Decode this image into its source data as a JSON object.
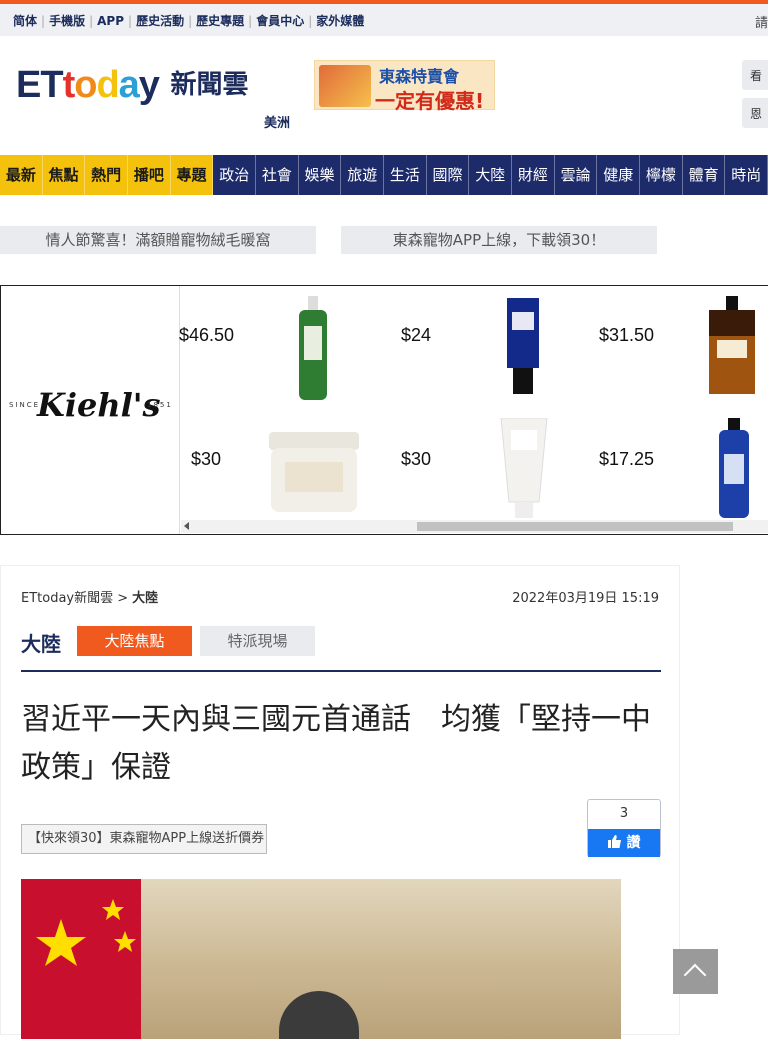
{
  "topbar": {
    "links": [
      "简体",
      "手機版",
      "APP",
      "歷史活動",
      "歷史專題",
      "會員中心",
      "家外媒體"
    ],
    "right_text": "請"
  },
  "header": {
    "logo_et": "ETtoday",
    "logo_cn": "新聞雲",
    "region": "美洲",
    "ad_line1": "東森特賣會",
    "ad_line2": "一定有優惠!",
    "side_buttons": [
      "看",
      "恩"
    ]
  },
  "nav": {
    "highlight": [
      "最新",
      "焦點",
      "熱門",
      "播吧",
      "專題"
    ],
    "items": [
      "政治",
      "社會",
      "娛樂",
      "旅遊",
      "生活",
      "國際",
      "大陸",
      "財經",
      "雲論",
      "健康",
      "檸檬",
      "體育",
      "時尚"
    ]
  },
  "promos": [
    "情人節驚喜！滿額贈寵物絨毛暖窩",
    "東森寵物APP上線，下載領30！"
  ],
  "ad": {
    "brand": "Kiehl's",
    "since": "SINCE",
    "year": "1851",
    "prices": [
      "$46.50",
      "$24",
      "$31.50",
      "$30",
      "$30",
      "$17.25"
    ]
  },
  "article": {
    "breadcrumb_root": "ETtoday新聞雲 >",
    "breadcrumb_current": "大陸",
    "date": "2022年03月19日 15:19",
    "category": "大陸",
    "tabs": [
      "大陸焦點",
      "特派現場"
    ],
    "title": "習近平一天內與三國元首通話　均獲「堅持一中政策」保證",
    "promo_link": "【快來領30】東森寵物APP上線送折價券",
    "like_count": "3",
    "like_label": "讚"
  },
  "colors": {
    "accent": "#f05a1e",
    "navy": "#1c2c5c",
    "nav_bg": "#1d2b6b",
    "nav_highlight": "#f4c20d",
    "fb_blue": "#1877f2"
  }
}
